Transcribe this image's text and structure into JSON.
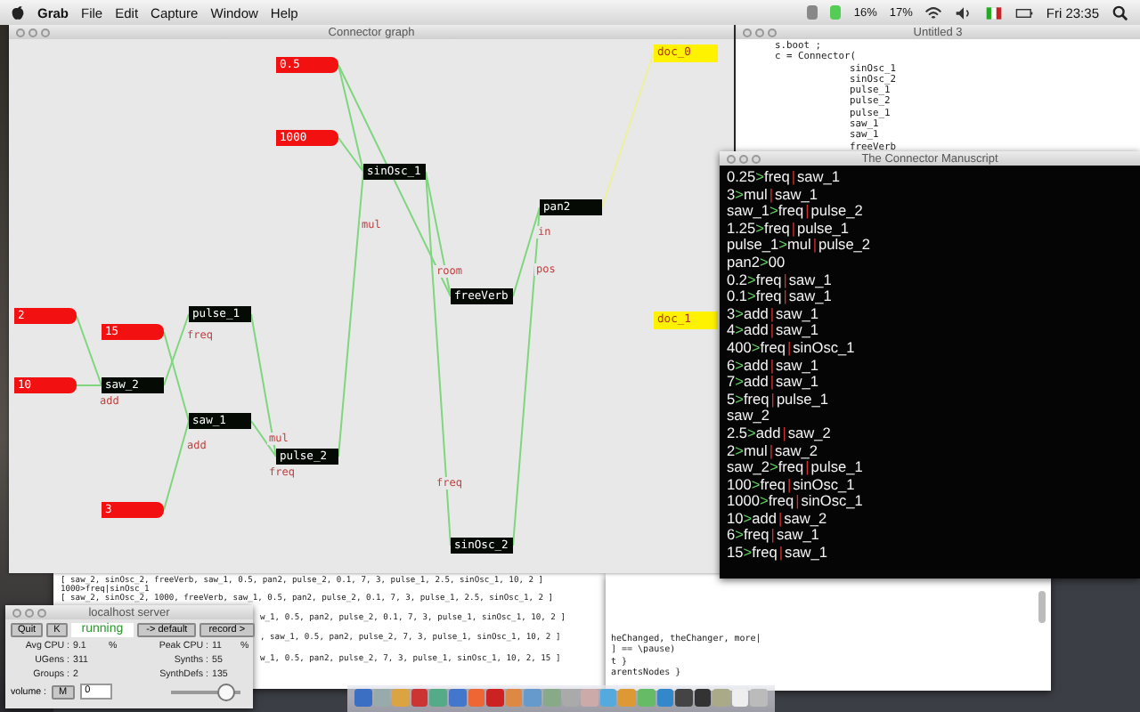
{
  "menu_bar": {
    "app": "Grab",
    "items": [
      "File",
      "Edit",
      "Capture",
      "Window",
      "Help"
    ],
    "status": [
      "16%",
      "17%"
    ],
    "clock": "Fri 23:35"
  },
  "graph_window": {
    "title": "Connector graph",
    "nodes": [
      {
        "label": "0.5",
        "kind": "number"
      },
      {
        "label": "1000",
        "kind": "number"
      },
      {
        "label": "sinOsc_1",
        "kind": "ugen"
      },
      {
        "label": "pan2",
        "kind": "ugen"
      },
      {
        "label": "freeVerb",
        "kind": "ugen"
      },
      {
        "label": "2",
        "kind": "number"
      },
      {
        "label": "15",
        "kind": "number"
      },
      {
        "label": "pulse_1",
        "kind": "ugen"
      },
      {
        "label": "10",
        "kind": "number"
      },
      {
        "label": "saw_2",
        "kind": "ugen"
      },
      {
        "label": "saw_1",
        "kind": "ugen"
      },
      {
        "label": "pulse_2",
        "kind": "ugen"
      },
      {
        "label": "3",
        "kind": "number"
      },
      {
        "label": "sinOsc_2",
        "kind": "ugen"
      },
      {
        "label": "doc_0",
        "kind": "doc"
      },
      {
        "label": "doc_1",
        "kind": "doc"
      }
    ],
    "port_labels": [
      "add",
      "freq",
      "add",
      "mul",
      "freq",
      "mul",
      "room",
      "in",
      "pos",
      "freq"
    ]
  },
  "untitled_window": {
    "title": "Untitled 3",
    "lines": [
      "s.boot ;",
      "c = Connector("
    ],
    "args": [
      "sinOsc_1",
      "sinOsc_2",
      "pulse_1",
      "pulse_2",
      "pulse_1",
      "saw_1",
      "saw_1",
      "freeVerb"
    ]
  },
  "manuscript_window": {
    "title": "The Connector Manuscript",
    "lines": [
      {
        "segments": [
          "0.25",
          ">",
          "freq",
          "|",
          "saw_1"
        ]
      },
      {
        "segments": [
          "3",
          ">",
          "mul",
          "|",
          "saw_1"
        ]
      },
      {
        "segments": [
          "saw_1",
          ">",
          "freq",
          "|",
          "pulse_2"
        ]
      },
      {
        "segments": [
          "1.25",
          ">",
          "freq",
          "|",
          "pulse_1"
        ]
      },
      {
        "segments": [
          "pulse_1",
          ">",
          "mul",
          "|",
          "pulse_2"
        ]
      },
      {
        "segments": [
          "pan2",
          ">",
          "00"
        ]
      },
      {
        "segments": [
          "0.2",
          ">",
          "freq",
          "|",
          "saw_1"
        ]
      },
      {
        "segments": [
          "0.1",
          ">",
          "freq",
          "|",
          "saw_1"
        ]
      },
      {
        "segments": [
          "3",
          ">",
          "add",
          "|",
          "saw_1"
        ]
      },
      {
        "segments": [
          "4",
          ">",
          "add",
          "|",
          "saw_1"
        ]
      },
      {
        "segments": [
          "400",
          ">",
          "freq",
          "|",
          "sinOsc_1"
        ]
      },
      {
        "segments": [
          "6",
          ">",
          "add",
          "|",
          "saw_1"
        ]
      },
      {
        "segments": [
          "7",
          ">",
          "add",
          "|",
          "saw_1"
        ]
      },
      {
        "segments": [
          "5",
          ">",
          "freq",
          "|",
          "pulse_1"
        ]
      },
      {
        "segments": [
          "saw_2"
        ]
      },
      {
        "segments": [
          "2.5",
          ">",
          "add",
          "|",
          "saw_2"
        ]
      },
      {
        "segments": [
          "2",
          ">",
          "mul",
          "|",
          "saw_2"
        ]
      },
      {
        "segments": [
          "saw_2",
          ">",
          "freq",
          "|",
          "pulse_1"
        ]
      },
      {
        "segments": [
          "100",
          ">",
          "freq",
          "|",
          "sinOsc_1"
        ]
      },
      {
        "segments": [
          "1000",
          ">",
          "freq",
          "|",
          "sinOsc_1"
        ]
      },
      {
        "segments": [
          "10",
          ">",
          "add",
          "|",
          "saw_2"
        ]
      },
      {
        "segments": [
          "6",
          ">",
          "freq",
          "|",
          "saw_1"
        ]
      },
      {
        "segments": [
          "15",
          ">",
          "freq",
          "|",
          "saw_1"
        ]
      }
    ]
  },
  "post_window": {
    "lines": [
      {
        "text": "[ saw_2, sinOsc_2, freeVerb, saw_1, 0.5, pan2, pulse_2, 0.1, 7, 3, pulse_1, 2.5, sinOsc_1, 10, 2 ]",
        "kind": "full"
      },
      {
        "text": "1000>freq|sinOsc_1",
        "kind": "full"
      },
      {
        "text": "[ saw_2, sinOsc_2, 1000, freeVerb, saw_1, 0.5, pan2, pulse_2, 0.1, 7, 3, pulse_1, 2.5, sinOsc_1, 2 ]",
        "kind": "full"
      },
      {
        "text": "w_1, 0.5, pan2, pulse_2, 0.1, 7, 3, pulse_1, sinOsc_1, 10, 2 ]",
        "kind": "covered"
      },
      {
        "text": ", saw_1, 0.5, pan2, pulse_2, 7, 3, pulse_1, sinOsc_1, 10, 2 ]",
        "kind": "covered"
      },
      {
        "text": "w_1, 0.5, pan2, pulse_2, 7, 3, pulse_1, sinOsc_1, 10, 2, 15 ]",
        "kind": "covered"
      }
    ]
  },
  "editor_window": {
    "lines": [
      "heChanged, theChanger, more|",
      "] == \\pause)",
      "t }",
      "arentsNodes }"
    ]
  },
  "server": {
    "title": "localhost server",
    "buttons": [
      "Quit",
      "K"
    ],
    "status": "running",
    "menus": [
      "-> default",
      "record >"
    ],
    "stats": [
      {
        "label": "Avg CPU :",
        "value": "9.1",
        "unit": "%"
      },
      {
        "label": "Peak CPU :",
        "value": "11",
        "unit": "%"
      },
      {
        "label": "UGens :",
        "value": "311"
      },
      {
        "label": "Synths :",
        "value": "55"
      },
      {
        "label": "Groups :",
        "value": "2"
      },
      {
        "label": "SynthDefs :",
        "value": "135"
      }
    ],
    "volume": {
      "label": "volume :",
      "mute": "M",
      "value": "0",
      "level": 0.8
    }
  }
}
